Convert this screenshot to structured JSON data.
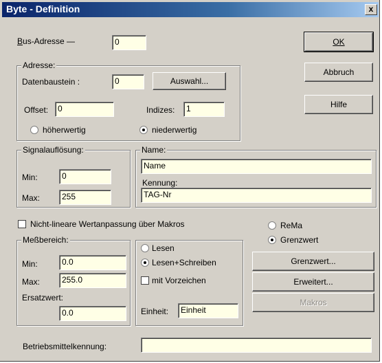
{
  "window": {
    "title": "Byte - Definition",
    "close_glyph": "x"
  },
  "bus": {
    "label_pre": "B",
    "label_post": "us-Adresse —",
    "value": "0"
  },
  "buttons": {
    "ok_label": "OK",
    "abbruch_label": "Abbruch",
    "hilfe_label": "Hilfe",
    "auswahl_label": "Auswahl...",
    "grenzwert_label": "Grenzwert...",
    "erweitert_label": "Erweitert...",
    "makros_label": "Makros"
  },
  "adresse": {
    "title": "Adresse:",
    "datenbaustein_label": "Datenbaustein :",
    "datenbaustein_value": "0",
    "offset_label": "Offset:",
    "offset_value": "0",
    "indizes_label": "Indizes:",
    "indizes_value": "1",
    "hoeherwertig_label": "höherwertig",
    "niederwertig_label": "niederwertig"
  },
  "signal": {
    "title": "Signalauflösung:",
    "min_label": "Min:",
    "min_value": "0",
    "max_label": "Max:",
    "max_value": "255"
  },
  "name_group": {
    "title": "Name:",
    "name_value": "Name",
    "kennung_label": "Kennung:",
    "kennung_value": "TAG-Nr"
  },
  "nichtlinear": {
    "label": "Nicht-lineare Wertanpassung über Makros"
  },
  "mode": {
    "rema_label": "ReMa",
    "grenzwert_label": "Grenzwert"
  },
  "messbereich": {
    "title": "Meßbereich:",
    "min_label": "Min:",
    "min_value": "0.0",
    "max_label": "Max:",
    "max_value": "255.0",
    "ersatz_label": "Ersatzwert:",
    "ersatz_value": "0.0"
  },
  "access": {
    "lesen_label": "Lesen",
    "lesen_schreiben_label": "Lesen+Schreiben",
    "vorzeichen_label": "mit Vorzeichen",
    "einheit_label": "Einheit:",
    "einheit_value": "Einheit"
  },
  "betrieb": {
    "label": "Betriebsmittelkennung:",
    "value": ""
  }
}
